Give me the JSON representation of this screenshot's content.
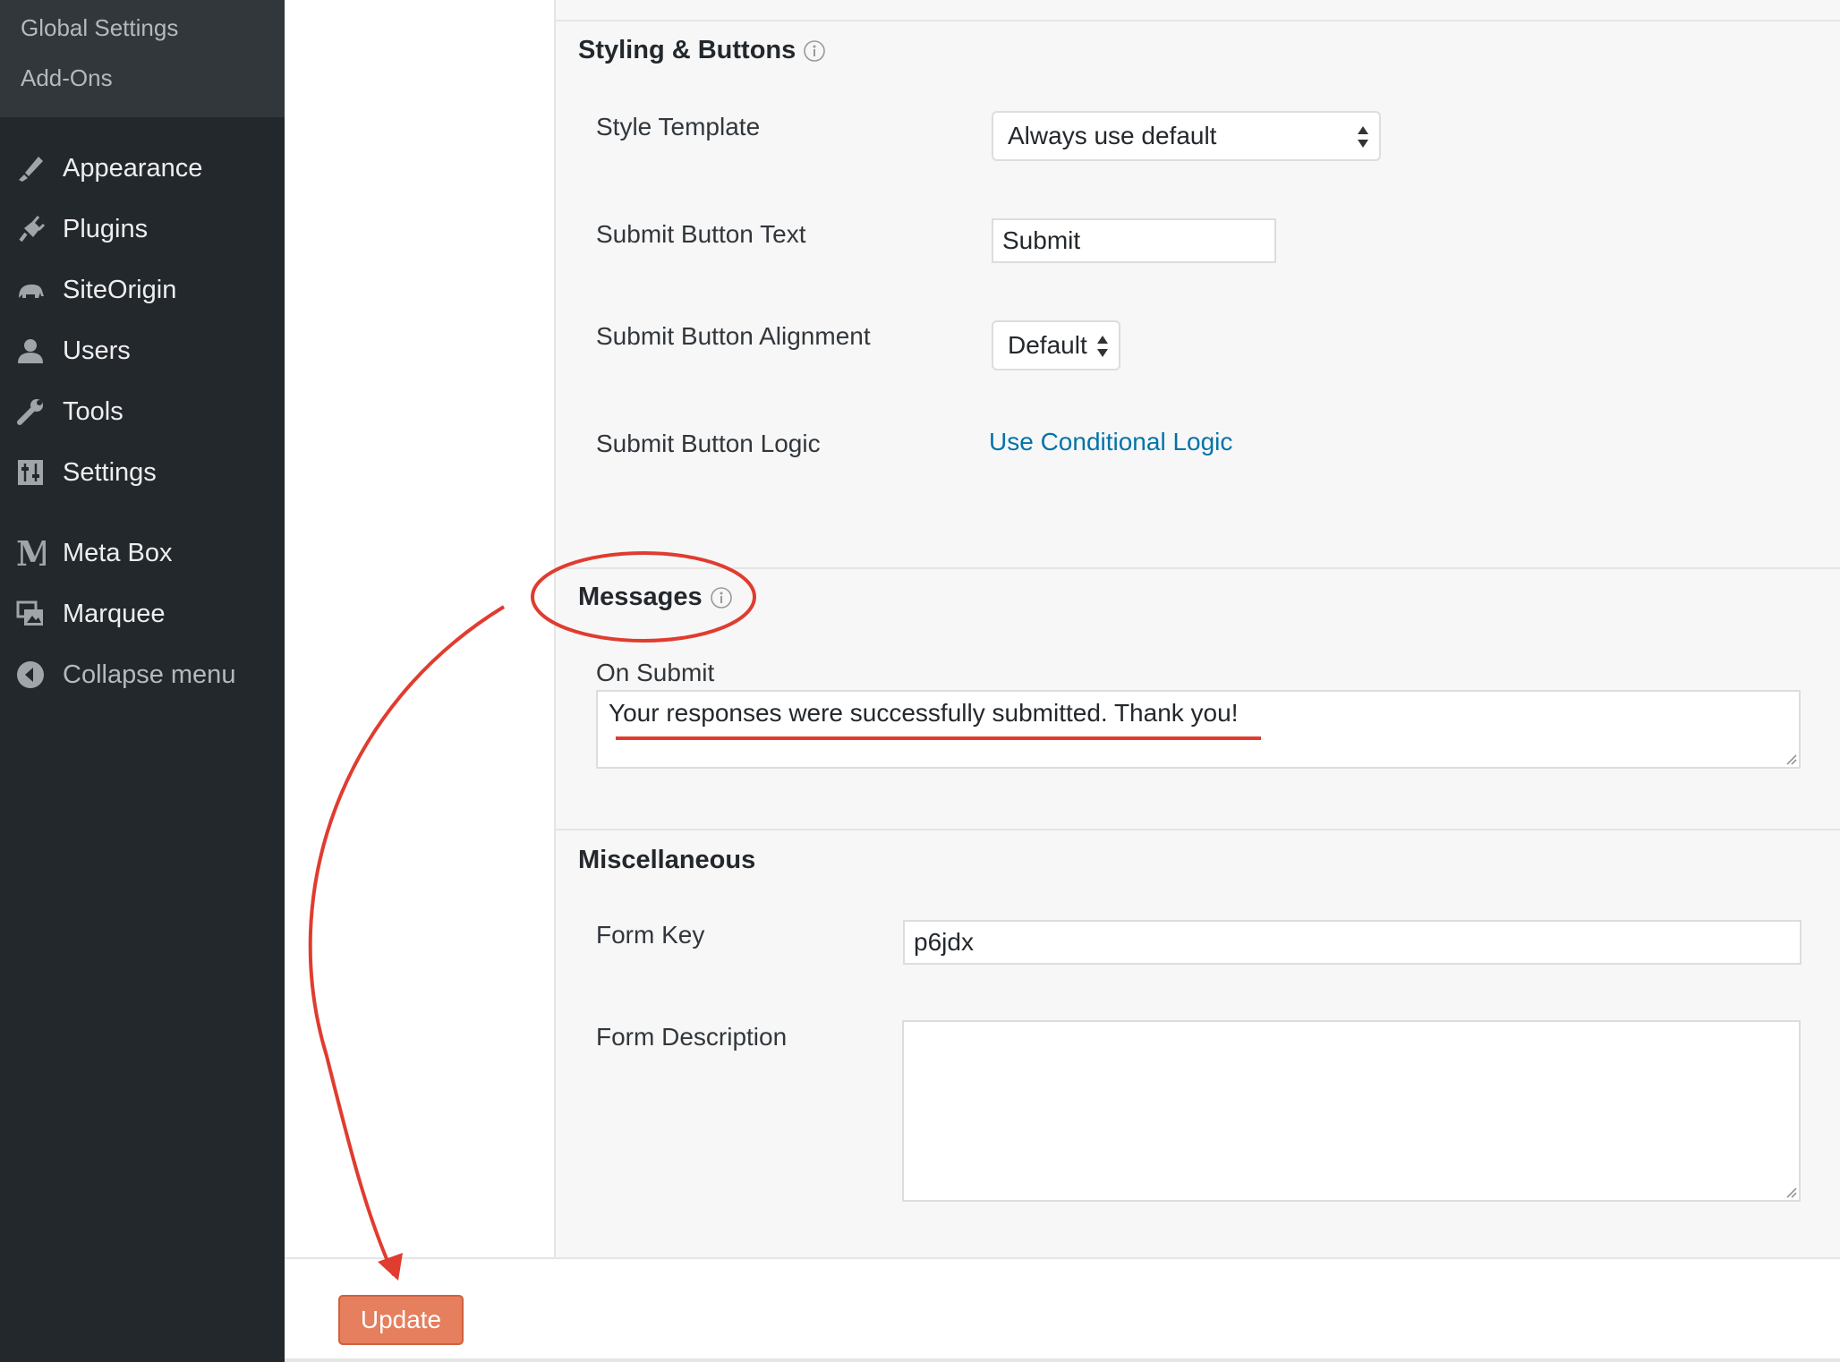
{
  "sidebar": {
    "submenu": [
      "Global Settings",
      "Add-Ons"
    ],
    "items": [
      {
        "label": "Appearance",
        "icon": "paintbrush-icon"
      },
      {
        "label": "Plugins",
        "icon": "plug-icon"
      },
      {
        "label": "SiteOrigin",
        "icon": "elephant-icon"
      },
      {
        "label": "Users",
        "icon": "user-icon"
      },
      {
        "label": "Tools",
        "icon": "wrench-icon"
      },
      {
        "label": "Settings",
        "icon": "sliders-icon"
      },
      {
        "label": "Meta Box",
        "icon": "m-letter-icon"
      },
      {
        "label": "Marquee",
        "icon": "gallery-icon"
      },
      {
        "label": "Collapse menu",
        "icon": "collapse-arrow-icon"
      }
    ]
  },
  "styling": {
    "title": "Styling & Buttons",
    "style_template_label": "Style Template",
    "style_template_value": "Always use default",
    "submit_text_label": "Submit Button Text",
    "submit_text_value": "Submit",
    "alignment_label": "Submit Button Alignment",
    "alignment_value": "Default",
    "logic_label": "Submit Button Logic",
    "logic_link": "Use Conditional Logic"
  },
  "messages": {
    "title": "Messages",
    "on_submit_label": "On Submit",
    "on_submit_value": "Your responses were successfully submitted. Thank you!"
  },
  "misc": {
    "title": "Miscellaneous",
    "form_key_label": "Form Key",
    "form_key_value": "p6jdx",
    "form_description_label": "Form Description",
    "form_description_value": ""
  },
  "footer": {
    "update_label": "Update"
  },
  "colors": {
    "sidebar_bg": "#23282d",
    "link": "#0073aa",
    "update_button": "#e57f5d",
    "annotation_red": "#e03c2f"
  }
}
